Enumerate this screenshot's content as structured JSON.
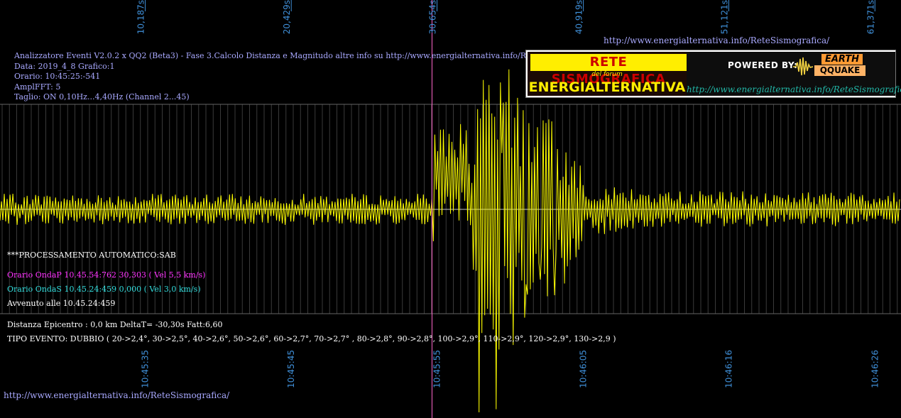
{
  "header": {
    "line1": "Analizzatore Eventi V2.0.2 x QQ2 (Beta3) - Fase 3.Calcolo Distanza e Magnitudo altre info su http://www.energialternativa.info/ReteSismografica",
    "line2": "Data: 2019_4_8 Grafico:1",
    "line3": "Orario: 10:45:25:-541",
    "line4": "AmplFFT: 5",
    "line5": "Taglio: ON 0,10Hz...4,40Hz       (Channel 2...45)"
  },
  "url_top": "http://www.energialternativa.info/ReteSismografica/",
  "url_bottom": "http://www.energialternativa.info/ReteSismografica/",
  "logo": {
    "rete": "RETE SISMOGRAFICA",
    "del_forum": "del forum",
    "energialternativa": "ENERGIALTERNATIVA",
    "powered_by": "POWERED BY:",
    "earth": "EARTH",
    "quake": "QQUAKE",
    "url": "http://www.energialternativa.info/ReteSismografica"
  },
  "processing": {
    "auto": "***PROCESSAMENTO AUTOMATICO:SAB",
    "onda_p": "Orario OndaP 10.45.54:762  30,303 ( Vel 5,5 km/s)",
    "onda_s": "Orario OndaS 10.45.24:459  0,000 ( Vel 3,0 km/s)",
    "avvenuto": "Avvenuto alle 10.45.24:459",
    "distanza": "Distanza Epicentro : 0,0 km DeltaT= -30,30s  Fatt:6,60",
    "tipo": "TIPO EVENTO: DUBBIO ( 20->2,4°, 30->2,5°, 40->2,6°, 50->2,6°, 60->2,7°, 70->2,7° , 80->2,8°, 90->2,8°, 100->2,9°, 110->2,9°, 120->2,9°, 130->2,9 )"
  },
  "colors": {
    "trace": "#ffff00",
    "p_marker": "#ff66cc",
    "axis_label": "#3f8fd8",
    "grid": "#3a3a3a",
    "baseline": "#c8c8c8"
  },
  "chart_data": {
    "type": "line",
    "title": "",
    "xlabel": "",
    "ylabel": "",
    "grid": true,
    "top_ticks": [
      "10,187s",
      "20,429s",
      "30,654s",
      "40,919s",
      "51,121s",
      "61,371s"
    ],
    "top_tick_values_s": [
      10.187,
      20.429,
      30.654,
      40.919,
      51.121,
      61.371
    ],
    "bottom_ticks": [
      "10:45:35",
      "10:45:45",
      "10:45:55",
      "10:46:05",
      "10:46:16",
      "10:46:26"
    ],
    "bottom_tick_values_s": [
      10.187,
      20.429,
      30.654,
      40.919,
      51.121,
      61.371
    ],
    "x_range_s": [
      0,
      63.2
    ],
    "y_range": [
      -13.5,
      4.5
    ],
    "p_wave_s": 30.303,
    "series": [
      {
        "envelope": [
          [
            0,
            1.0
          ],
          [
            29.5,
            1.0
          ],
          [
            30.3,
            1.0
          ],
          [
            30.5,
            3.3
          ],
          [
            32.8,
            3.3
          ],
          [
            33.0,
            4.0
          ],
          [
            34.0,
            9.0
          ],
          [
            36.0,
            9.0
          ],
          [
            38.0,
            6.5
          ],
          [
            39.5,
            5.0
          ],
          [
            40.5,
            4.0
          ],
          [
            41.0,
            1.8
          ],
          [
            45.0,
            1.2
          ],
          [
            63.2,
            1.1
          ]
        ],
        "offset": [
          [
            0,
            0
          ],
          [
            30.4,
            0
          ],
          [
            30.5,
            2.3
          ],
          [
            32.8,
            2.3
          ],
          [
            33.1,
            0
          ],
          [
            63.2,
            0
          ]
        ],
        "peaks": [
          {
            "x": 33.6,
            "y": -13.0
          },
          {
            "x": 34.8,
            "y": -12.8
          },
          {
            "x": 36.9,
            "y": -4.8
          },
          {
            "x": 37.9,
            "y": -4.5
          },
          {
            "x": 38.9,
            "y": -5.5
          },
          {
            "x": 35.2,
            "y": 3.6
          },
          {
            "x": 40.3,
            "y": 3.1
          }
        ]
      }
    ]
  }
}
